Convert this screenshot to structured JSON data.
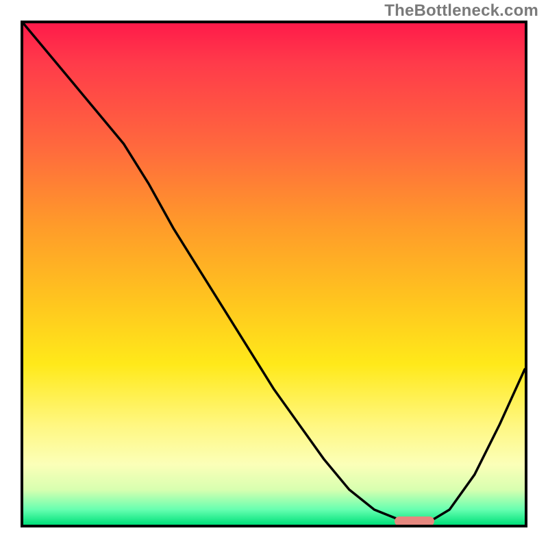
{
  "watermark": "TheBottleneck.com",
  "chart_data": {
    "type": "line",
    "title": "",
    "xlabel": "",
    "ylabel": "",
    "x": [
      0.0,
      0.05,
      0.1,
      0.15,
      0.2,
      0.25,
      0.3,
      0.35,
      0.4,
      0.45,
      0.5,
      0.55,
      0.6,
      0.65,
      0.7,
      0.75,
      0.8,
      0.85,
      0.9,
      0.95,
      1.0
    ],
    "y": [
      1.0,
      0.94,
      0.88,
      0.82,
      0.76,
      0.68,
      0.59,
      0.51,
      0.43,
      0.35,
      0.27,
      0.2,
      0.13,
      0.07,
      0.03,
      0.01,
      0.0,
      0.03,
      0.1,
      0.2,
      0.31
    ],
    "xlim": [
      0,
      1
    ],
    "ylim": [
      0,
      1
    ],
    "marker": {
      "x_start": 0.74,
      "x_end": 0.82,
      "y": 0.005
    },
    "background_gradient": {
      "top": "#ff1b4a",
      "mid": "#ffe91a",
      "bottom": "#00e07a"
    }
  }
}
